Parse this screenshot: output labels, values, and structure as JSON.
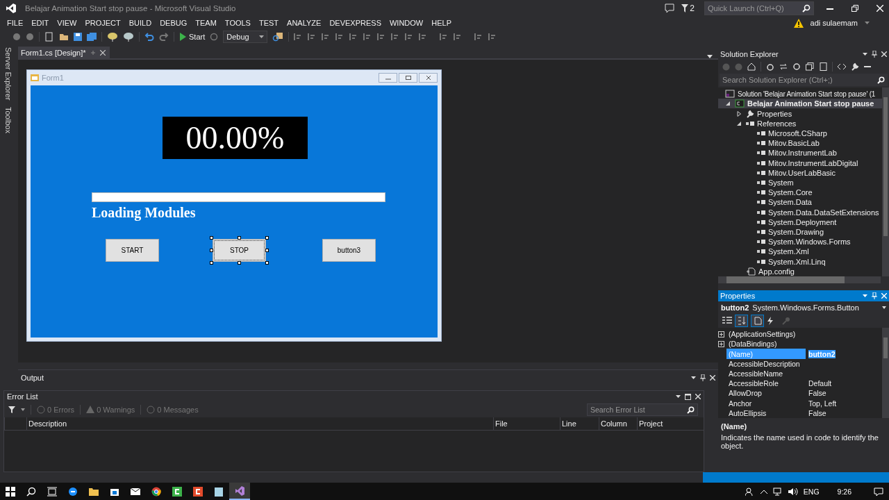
{
  "window": {
    "title": "Belajar Animation Start stop pause - Microsoft Visual Studio"
  },
  "title_bar": {
    "notifications": "2",
    "quick_launch": {
      "placeholder": "Quick Launch (Ctrl+Q)"
    },
    "user": "adi sulaemam"
  },
  "menu": [
    "FILE",
    "EDIT",
    "VIEW",
    "PROJECT",
    "BUILD",
    "DEBUG",
    "TEAM",
    "TOOLS",
    "TEST",
    "ANALYZE",
    "DEVEXPRESS",
    "WINDOW",
    "HELP"
  ],
  "toolbar": {
    "start": "Start",
    "configuration": "Debug"
  },
  "side_tabs": [
    "Server Explorer",
    "Toolbox"
  ],
  "document_tabs": [
    {
      "label": "Form1.cs [Design]*",
      "selected": true
    }
  ],
  "form": {
    "title": "Form1",
    "display": "00.00%",
    "progress": {
      "level": 0
    },
    "label": "Loading Modules",
    "buttons": [
      {
        "label": "START",
        "selected": false
      },
      {
        "label": "STOP",
        "selected": true
      },
      {
        "label": "button3",
        "selected": false
      }
    ]
  },
  "output": {
    "title": "Output"
  },
  "error_list": {
    "title": "Error List",
    "filters": [
      "0 Errors",
      "0 Warnings",
      "0 Messages"
    ],
    "search": {
      "placeholder": "Search Error List"
    },
    "columns": [
      "Description",
      "File",
      "Line",
      "Column",
      "Project"
    ]
  },
  "solution_explorer": {
    "title": "Solution Explorer",
    "search": {
      "placeholder": "Search Solution Explorer (Ctrl+;)"
    },
    "tree": [
      {
        "label": "Solution 'Belajar Animation Start stop pause' (1",
        "kind": "solution",
        "children": [
          {
            "label": "Belajar Animation Start stop pause",
            "kind": "project",
            "expanded": true,
            "children": [
              {
                "label": "Properties",
                "kind": "properties",
                "expanded": false
              },
              {
                "label": "References",
                "kind": "references",
                "expanded": true,
                "children": [
                  {
                    "label": "Microsoft.CSharp",
                    "kind": "reference"
                  },
                  {
                    "label": "Mitov.BasicLab",
                    "kind": "reference"
                  },
                  {
                    "label": "Mitov.InstrumentLab",
                    "kind": "reference"
                  },
                  {
                    "label": "Mitov.InstrumentLabDigital",
                    "kind": "reference"
                  },
                  {
                    "label": "Mitov.UserLabBasic",
                    "kind": "reference"
                  },
                  {
                    "label": "System",
                    "kind": "reference"
                  },
                  {
                    "label": "System.Core",
                    "kind": "reference"
                  },
                  {
                    "label": "System.Data",
                    "kind": "reference"
                  },
                  {
                    "label": "System.Data.DataSetExtensions",
                    "kind": "reference"
                  },
                  {
                    "label": "System.Deployment",
                    "kind": "reference"
                  },
                  {
                    "label": "System.Drawing",
                    "kind": "reference"
                  },
                  {
                    "label": "System.Windows.Forms",
                    "kind": "reference"
                  },
                  {
                    "label": "System.Xml",
                    "kind": "reference"
                  },
                  {
                    "label": "System.Xml.Linq",
                    "kind": "reference"
                  }
                ]
              },
              {
                "label": "App.config",
                "kind": "config"
              }
            ]
          }
        ]
      }
    ]
  },
  "properties": {
    "title": "Properties",
    "object": "button2",
    "type": "System.Windows.Forms.Button",
    "rows": [
      {
        "kind": "category",
        "name": "(ApplicationSettings)",
        "expanded": false,
        "selected": false
      },
      {
        "kind": "category",
        "name": "(DataBindings)",
        "expanded": false,
        "selected": false
      },
      {
        "kind": "property",
        "name": "(Name)",
        "value": "button2",
        "selected": true
      },
      {
        "kind": "property",
        "name": "AccessibleDescription",
        "selected": false
      },
      {
        "kind": "property",
        "name": "AccessibleName",
        "selected": false
      },
      {
        "kind": "property",
        "name": "AccessibleRole",
        "value": "Default",
        "selected": false
      },
      {
        "kind": "property",
        "name": "AllowDrop",
        "value": "False",
        "selected": false
      },
      {
        "kind": "property",
        "name": "Anchor",
        "value": "Top, Left",
        "selected": false
      },
      {
        "kind": "property",
        "name": "AutoEllipsis",
        "value": "False",
        "selected": false
      }
    ],
    "description": {
      "title": "(Name)",
      "text": "Indicates the name used in code to identify the object."
    }
  },
  "taskbar": {
    "language": "ENG",
    "time": "9:26"
  }
}
